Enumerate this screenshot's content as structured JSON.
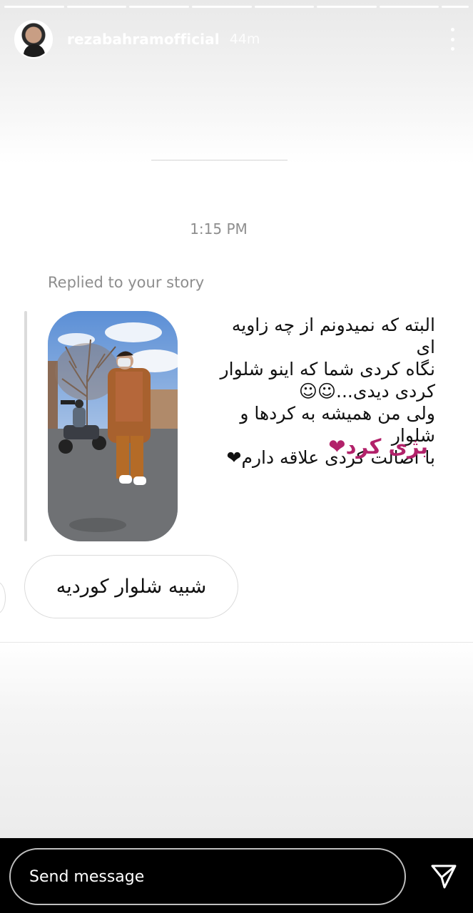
{
  "header": {
    "username": "rezabahramofficial",
    "time_ago": "44m"
  },
  "progress": {
    "segments": 8,
    "current_index": 7
  },
  "dm": {
    "timestamp": "1:15 PM",
    "replied_label": "Replied to your story",
    "story_caption_lines": [
      "البته که نمیدونم از چه زاویه ای",
      "نگاه کردی شما که اینو شلوار",
      "کردی دیدی...☺☺",
      "ولی من همیشه به کردها و شلوار",
      "با اصالت کردی علاقه دارم❤"
    ],
    "story_sub_caption": "بژی کرد❤",
    "message_text": "شبیه شلوار کوردیه"
  },
  "composer": {
    "placeholder": "Send message",
    "send_icon": "paper-plane-icon"
  },
  "colors": {
    "sub_caption": "#b2226a",
    "heart": "#e0192c",
    "muted_text": "#8e8e8e"
  }
}
